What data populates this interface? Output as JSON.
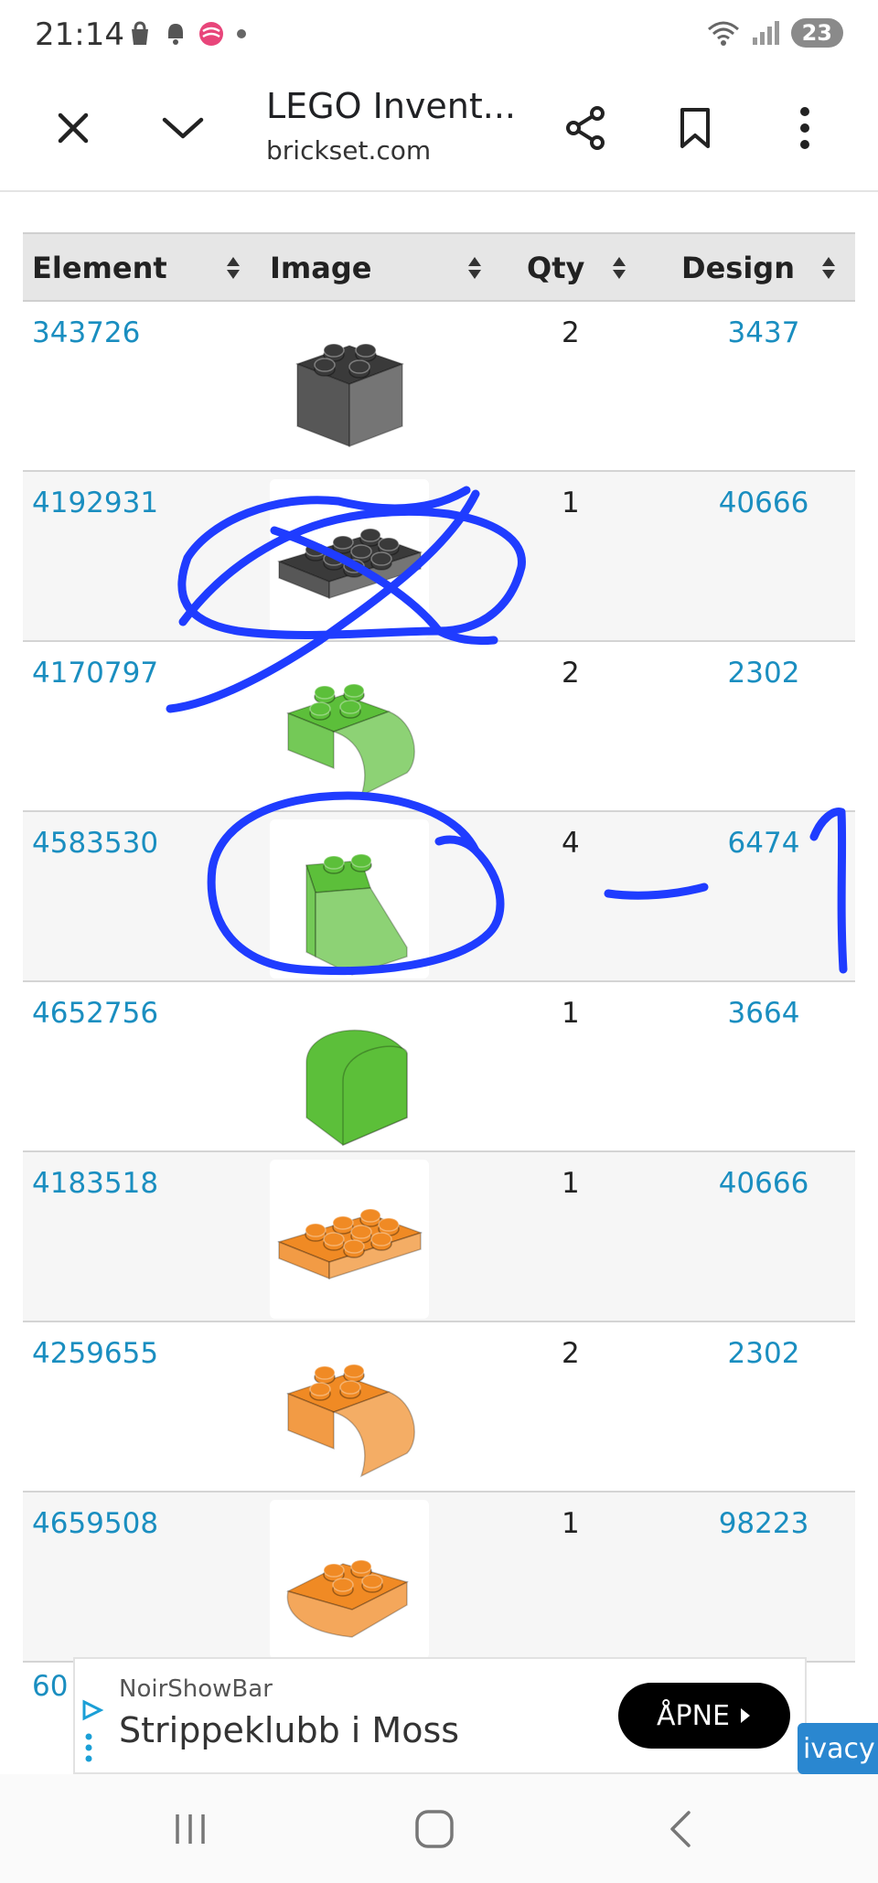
{
  "status": {
    "time": "21:14",
    "battery": "23"
  },
  "toolbar": {
    "title": "LEGO Invent...",
    "url": "brickset.com"
  },
  "table": {
    "headers": {
      "element": "Element",
      "image": "Image",
      "qty": "Qty",
      "design": "Design"
    },
    "rows": [
      {
        "element": "343726",
        "qty": "2",
        "design": "3437",
        "color": "#3a3a3a",
        "shape": "brick-2x2"
      },
      {
        "element": "4192931",
        "qty": "1",
        "design": "40666",
        "color": "#3a3a3a",
        "shape": "plate-2x4"
      },
      {
        "element": "4170797",
        "qty": "2",
        "design": "2302",
        "color": "#5cbf3a",
        "shape": "curved-2x2"
      },
      {
        "element": "4583530",
        "qty": "4",
        "design": "6474",
        "color": "#5cbf3a",
        "shape": "slope-1x2"
      },
      {
        "element": "4652756",
        "qty": "1",
        "design": "3664",
        "color": "#5cbf3a",
        "shape": "arch-1x2"
      },
      {
        "element": "4183518",
        "qty": "1",
        "design": "40666",
        "color": "#f08a24",
        "shape": "plate-2x4"
      },
      {
        "element": "4259655",
        "qty": "2",
        "design": "2302",
        "color": "#f08a24",
        "shape": "curved-2x2"
      },
      {
        "element": "4659508",
        "qty": "1",
        "design": "98223",
        "color": "#f08a24",
        "shape": "curved-plate-2x2"
      }
    ],
    "partial_row_text": "60"
  },
  "ad": {
    "advertiser": "NoirShowBar",
    "title": "Strippeklubb i Moss",
    "button": "ÅPNE",
    "privacy": "ivacy"
  },
  "annotation": {
    "color": "#1f3cff",
    "marks": [
      "cross-out",
      "circle",
      "dash",
      "one"
    ]
  }
}
